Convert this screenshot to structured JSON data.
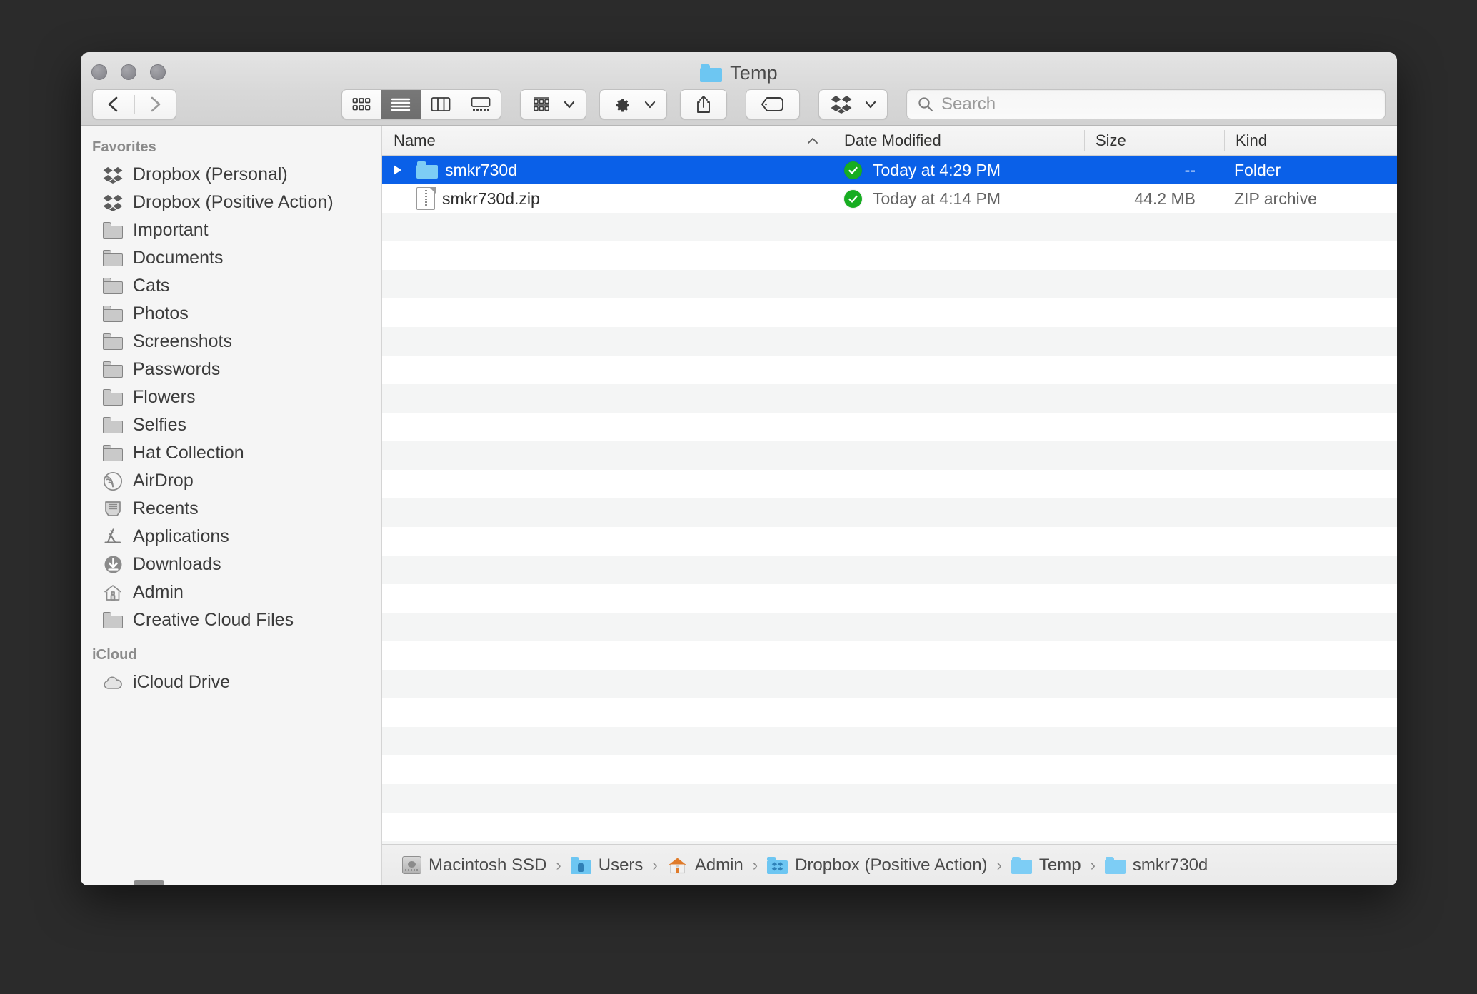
{
  "window": {
    "title": "Temp",
    "title_icon": "blue-folder-icon",
    "traffic_lights": [
      "close-button",
      "minimize-button",
      "zoom-button"
    ]
  },
  "toolbar": {
    "back_label": "Back",
    "forward_label": "Forward",
    "view_modes": [
      {
        "name": "icon-view",
        "label": "Icon View",
        "active": false
      },
      {
        "name": "list-view",
        "label": "List View",
        "active": true
      },
      {
        "name": "column-view",
        "label": "Column View",
        "active": false
      },
      {
        "name": "gallery-view",
        "label": "Gallery View",
        "active": false
      }
    ],
    "arrange_label": "Arrange By",
    "action_label": "Action",
    "share_label": "Share",
    "tags_label": "Tags",
    "dropbox_label": "Dropbox"
  },
  "search": {
    "placeholder": "Search",
    "value": ""
  },
  "sidebar": {
    "sections": [
      {
        "header": "Favorites",
        "items": [
          {
            "icon": "dropbox-icon",
            "label": "Dropbox (Personal)"
          },
          {
            "icon": "dropbox-icon",
            "label": "Dropbox (Positive Action)"
          },
          {
            "icon": "folder-icon",
            "label": "Important"
          },
          {
            "icon": "folder-icon",
            "label": "Documents"
          },
          {
            "icon": "folder-icon",
            "label": "Cats"
          },
          {
            "icon": "folder-icon",
            "label": "Photos"
          },
          {
            "icon": "folder-icon",
            "label": "Screenshots"
          },
          {
            "icon": "folder-icon",
            "label": "Passwords"
          },
          {
            "icon": "folder-icon",
            "label": "Flowers"
          },
          {
            "icon": "folder-icon",
            "label": "Selfies"
          },
          {
            "icon": "folder-icon",
            "label": "Hat Collection"
          },
          {
            "icon": "airdrop-icon",
            "label": "AirDrop"
          },
          {
            "icon": "recents-icon",
            "label": "Recents"
          },
          {
            "icon": "applications-icon",
            "label": "Applications"
          },
          {
            "icon": "downloads-icon",
            "label": "Downloads"
          },
          {
            "icon": "home-icon",
            "label": "Admin"
          },
          {
            "icon": "folder-icon",
            "label": "Creative Cloud Files"
          }
        ]
      },
      {
        "header": "iCloud",
        "items": [
          {
            "icon": "cloud-icon",
            "label": "iCloud Drive"
          }
        ]
      }
    ]
  },
  "file_list": {
    "columns": [
      {
        "key": "name",
        "label": "Name",
        "sorted": true,
        "sort_direction": "ascending"
      },
      {
        "key": "date",
        "label": "Date Modified",
        "sorted": false
      },
      {
        "key": "size",
        "label": "Size",
        "sorted": false
      },
      {
        "key": "kind",
        "label": "Kind",
        "sorted": false
      }
    ],
    "rows": [
      {
        "name": "smkr730d",
        "icon": "blue-folder-icon",
        "has_disclosure": true,
        "expanded": false,
        "sync_badge": "synced-check-icon",
        "date": "Today at 4:29 PM",
        "size": "--",
        "kind": "Folder",
        "selected": true
      },
      {
        "name": "smkr730d.zip",
        "icon": "zip-document-icon",
        "has_disclosure": false,
        "expanded": false,
        "sync_badge": "synced-check-icon",
        "date": "Today at 4:14 PM",
        "size": "44.2 MB",
        "kind": "ZIP archive",
        "selected": false
      }
    ],
    "empty_row_count": 24
  },
  "path_bar": {
    "segments": [
      {
        "icon": "hard-drive-icon",
        "label": "Macintosh SSD"
      },
      {
        "icon": "users-folder-icon",
        "label": "Users"
      },
      {
        "icon": "home-icon",
        "label": "Admin"
      },
      {
        "icon": "dropbox-folder-icon",
        "label": "Dropbox (Positive Action)"
      },
      {
        "icon": "blue-folder-icon",
        "label": "Temp"
      },
      {
        "icon": "blue-folder-icon",
        "label": "smkr730d"
      }
    ],
    "separator": "›"
  },
  "colors": {
    "selection_blue": "#0a60e8",
    "sync_green": "#17ad21",
    "folder_blue": "#6dc6f2",
    "desktop": "#2b2b2b",
    "sidebar_bg": "#f5f5f5",
    "stripe": "#f4f5f5"
  }
}
